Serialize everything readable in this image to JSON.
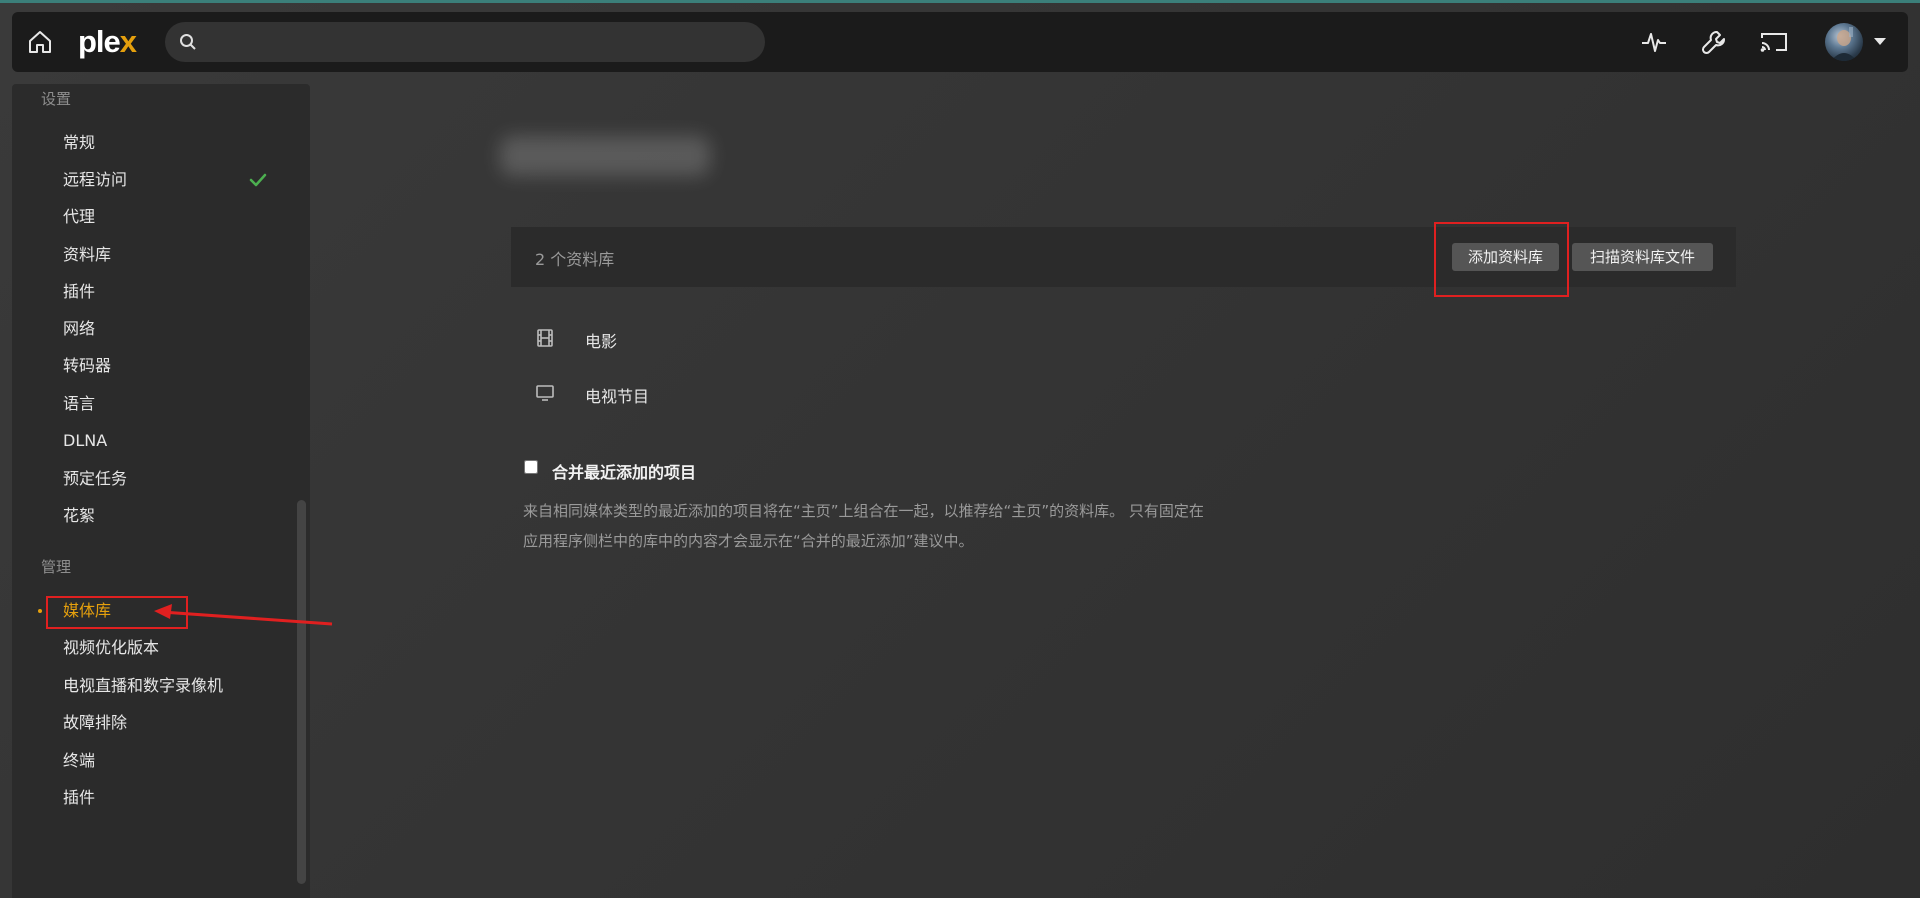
{
  "colors": {
    "accent": "#e5a00d",
    "check": "#4caf50",
    "annotation": "#e02020",
    "topbar": "#1b1b1b",
    "sidebar": "#2b2b2b"
  },
  "topbar": {
    "logo_main": "ple",
    "logo_x": "x",
    "search": {
      "placeholder": "",
      "value": ""
    },
    "icons": [
      "home-icon",
      "activity-icon",
      "wrench-icon",
      "cast-icon",
      "avatar"
    ]
  },
  "sidebar": {
    "settings_title": "设置",
    "settings_items": [
      {
        "label": "常规"
      },
      {
        "label": "远程访问",
        "status": "check"
      },
      {
        "label": "代理"
      },
      {
        "label": "资料库"
      },
      {
        "label": "插件"
      },
      {
        "label": "网络"
      },
      {
        "label": "转码器"
      },
      {
        "label": "语言"
      },
      {
        "label": "DLNA"
      },
      {
        "label": "预定任务"
      },
      {
        "label": "花絮"
      }
    ],
    "manage_title": "管理",
    "manage_items": [
      {
        "label": "媒体库",
        "active": true
      },
      {
        "label": "视频优化版本"
      },
      {
        "label": "电视直播和数字录像机"
      },
      {
        "label": "故障排除"
      },
      {
        "label": "终端"
      },
      {
        "label": "插件"
      }
    ]
  },
  "main": {
    "library_count": "2 个资料库",
    "add_button": "添加资料库",
    "scan_button": "扫描资料库文件",
    "libraries": [
      {
        "icon": "film-icon",
        "label": "电影"
      },
      {
        "icon": "tv-icon",
        "label": "电视节目"
      }
    ],
    "merge": {
      "label": "合并最近添加的项目",
      "checked": false,
      "description_line1": "来自相同媒体类型的最近添加的项目将在“主页”上组合在一起，以推荐给“主页”的资料库。 只有固定在",
      "description_line2": "应用程序侧栏中的库中的内容才会显示在“合并的最近添加”建议中。"
    }
  }
}
